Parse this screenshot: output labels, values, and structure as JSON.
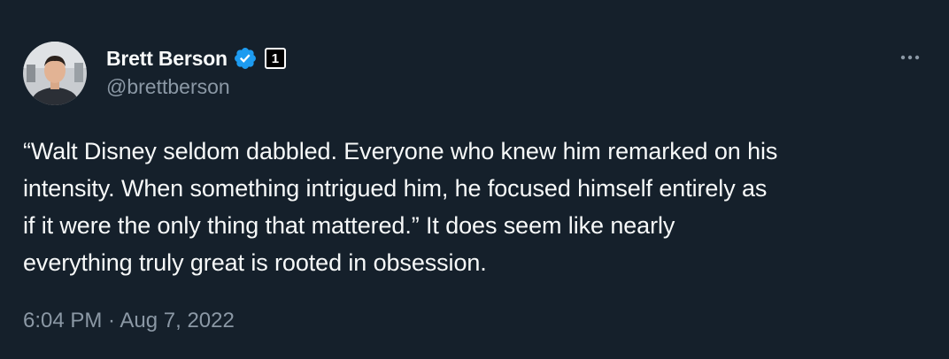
{
  "tweet": {
    "author": {
      "display_name": "Brett Berson",
      "handle": "@brettberson",
      "verified": true,
      "affiliation_badge": "1"
    },
    "text": "“Walt Disney seldom dabbled. Everyone who knew him remarked on his\nintensity. When something intrigued him, he focused himself entirely as\nif it were the only thing that mattered.” It does seem like nearly\neverything truly great is rooted in obsession.",
    "timestamp": "6:04 PM · Aug 7, 2022"
  },
  "icons": {
    "verified": "verified-badge-icon",
    "more": "more-options-icon"
  },
  "colors": {
    "background": "#15202b",
    "text_primary": "#f7f9f9",
    "text_secondary": "#8b98a5",
    "verified_blue": "#1d9bf0"
  }
}
